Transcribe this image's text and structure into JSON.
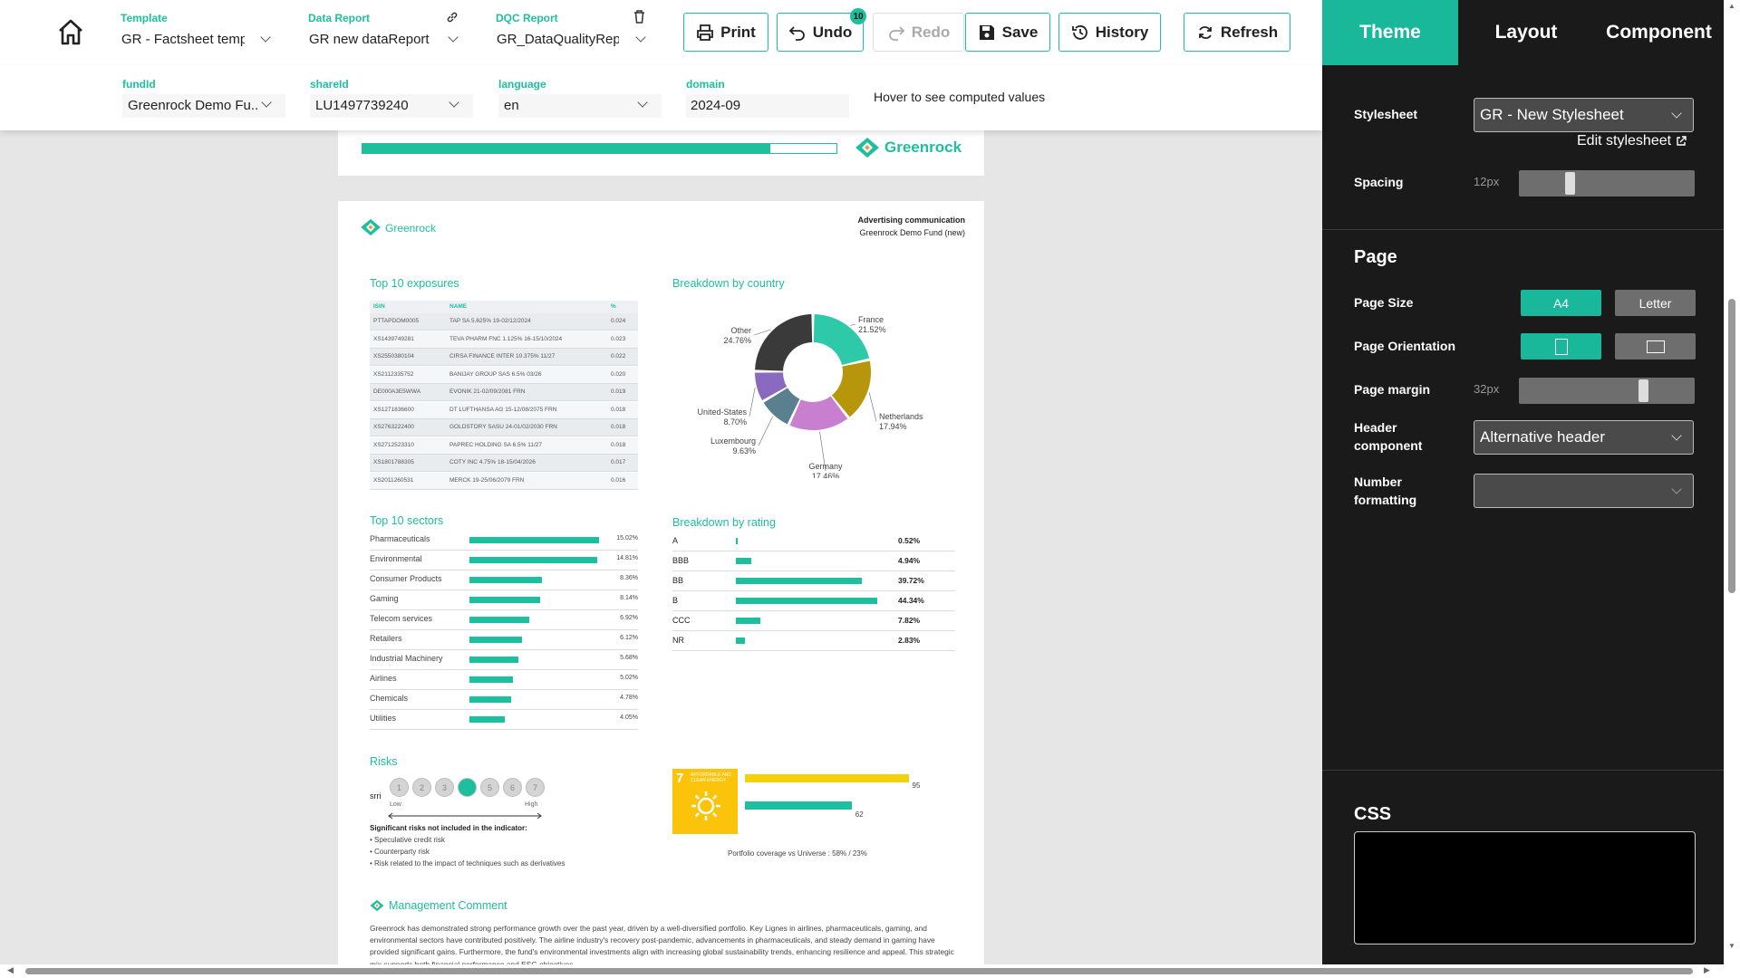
{
  "toolbar": {
    "home_icon": "home-icon",
    "template": {
      "label": "Template",
      "value": "GR - Factsheet temp"
    },
    "data_report": {
      "label": "Data Report",
      "value": "GR new dataReport",
      "icon": "link-icon"
    },
    "dqc_report": {
      "label": "DQC Report",
      "value": "GR_DataQualityRep",
      "icon": "trash-icon"
    },
    "buttons": {
      "print": "Print",
      "undo": "Undo",
      "undo_badge": "10",
      "redo": "Redo",
      "save": "Save",
      "history": "History",
      "refresh": "Refresh"
    }
  },
  "filters": {
    "fundid": {
      "label": "fundId",
      "value": "Greenrock Demo Fu..."
    },
    "shareid": {
      "label": "shareId",
      "value": "LU1497739240"
    },
    "language": {
      "label": "language",
      "value": "en"
    },
    "domain": {
      "label": "domain",
      "value": "2024-09"
    },
    "hint": "Hover to see computed values"
  },
  "panel": {
    "tabs": [
      "Theme",
      "Layout",
      "Component"
    ],
    "stylesheet_label": "Stylesheet",
    "stylesheet_value": "GR - New Stylesheet",
    "edit_stylesheet": "Edit stylesheet",
    "spacing_label": "Spacing",
    "spacing_value": "12px",
    "spacing_level": 0.28,
    "page_title": "Page",
    "page_size_label": "Page Size",
    "page_size_options": [
      "A4",
      "Letter"
    ],
    "page_size_selected": "A4",
    "orientation_label": "Page Orientation",
    "margin_label": "Page margin",
    "margin_value": "32px",
    "margin_level": 0.72,
    "header_label": "Header component",
    "header_value": "Alternative header",
    "number_label": "Number formatting",
    "number_value": "",
    "css_title": "CSS",
    "colors": {
      "accent": "#1dbf9f",
      "bg": "#1a1a1a"
    }
  },
  "doc": {
    "brand": "Greenrock",
    "adv": "Advertising communication",
    "fund": "Greenrock Demo Fund (new)",
    "top10_title": "Top 10 exposures",
    "top10_headers": [
      "ISIN",
      "NAME",
      "%"
    ],
    "top10_rows": [
      [
        "PTTAPDOM0005",
        "TAP SA 5.625% 19-02/12/2024",
        "0.024"
      ],
      [
        "XS1439749281",
        "TEVA PHARM FNC 1.125% 16-15/10/2024",
        "0.023"
      ],
      [
        "XS2550380104",
        "CIRSA FINANCE INTER 10.375% 11/27",
        "0.022"
      ],
      [
        "XS2112335752",
        "BANIJAY GROUP SAS 6.5% 03/26",
        "0.020"
      ],
      [
        "DE000A3E5WWA",
        "EVONIK 21-02/09/2081 FRN",
        "0.019"
      ],
      [
        "XS1271836600",
        "DT LUFTHANSA AG 15-12/08/2075 FRN",
        "0.018"
      ],
      [
        "XS2763222400",
        "GOLDSTORY SASU 24-01/02/2030 FRN",
        "0.018"
      ],
      [
        "XS2712523310",
        "PAPREC HOLDING SA 6.5% 11/27",
        "0.018"
      ],
      [
        "XS1801788305",
        "COTY INC 4.75% 18-15/04/2026",
        "0.017"
      ],
      [
        "XS2011260531",
        "MERCK 19-25/06/2079 FRN",
        "0.016"
      ]
    ],
    "country_title": "Breakdown by country",
    "countries": [
      {
        "name": "France",
        "value": 21.52,
        "label": "21.52%",
        "color": "#2ec9a8"
      },
      {
        "name": "Netherlands",
        "value": 17.94,
        "label": "17.94%",
        "color": "#b8960c"
      },
      {
        "name": "Germany",
        "value": 17.46,
        "label": "17.46%",
        "color": "#c97fd0"
      },
      {
        "name": "Luxembourg",
        "value": 9.63,
        "label": "9.63%",
        "color": "#5a7f8e"
      },
      {
        "name": "United-States",
        "value": 8.7,
        "label": "8.70%",
        "color": "#8a6ac0"
      },
      {
        "name": "Other",
        "value": 24.76,
        "label": "24.76%",
        "color": "#3a3a3a"
      }
    ],
    "sectors_title": "Top 10 sectors",
    "sectors": [
      {
        "name": "Pharmaceuticals",
        "value": 15.02,
        "label": "15.02%"
      },
      {
        "name": "Environmental",
        "value": 14.81,
        "label": "14.81%"
      },
      {
        "name": "Consumer Products",
        "value": 8.36,
        "label": "8.36%"
      },
      {
        "name": "Gaming",
        "value": 8.14,
        "label": "8.14%"
      },
      {
        "name": "Telecom services",
        "value": 6.92,
        "label": "6.92%"
      },
      {
        "name": "Retailers",
        "value": 6.12,
        "label": "6.12%"
      },
      {
        "name": "Industrial Machinery",
        "value": 5.68,
        "label": "5.68%"
      },
      {
        "name": "Airlines",
        "value": 5.02,
        "label": "5.02%"
      },
      {
        "name": "Chemicals",
        "value": 4.78,
        "label": "4.78%"
      },
      {
        "name": "Utilities",
        "value": 4.05,
        "label": "4.05%"
      }
    ],
    "rating_title": "Breakdown by rating",
    "ratings": [
      {
        "name": "A",
        "value": 0.52,
        "label": "0.52%"
      },
      {
        "name": "BBB",
        "value": 4.94,
        "label": "4.94%"
      },
      {
        "name": "BB",
        "value": 39.72,
        "label": "39.72%"
      },
      {
        "name": "B",
        "value": 44.34,
        "label": "44.34%"
      },
      {
        "name": "CCC",
        "value": 7.82,
        "label": "7.82%"
      },
      {
        "name": "NR",
        "value": 2.83,
        "label": "2.83%"
      }
    ],
    "risks_title": "Risks",
    "srri_label": "srri",
    "srri_levels": [
      "1",
      "2",
      "3",
      "4",
      "5",
      "6",
      "7"
    ],
    "srri_selected": 4,
    "risk_low": "Low",
    "risk_high": "High",
    "risk_note_title": "Significant risks not included in the indicator:",
    "risk_notes": [
      "• Speculative credit risk",
      "• Counterparty risk",
      "• Risk related to the impact of techniques such as derivatives"
    ],
    "sdg": {
      "number": "7",
      "caption": "AFFORDABLE AND CLEAN ENERGY",
      "portfolio": 95,
      "universe": 62,
      "portfolio_label": "95",
      "universe_label": "62",
      "coverage": "Portfolio coverage vs Universe : 58% / 23%"
    },
    "comment_title": "Management Comment",
    "comment_text": "Greenrock has demonstrated strong performance growth over the past year, driven by a well-diversified portfolio. Key Lignes in airlines, pharmaceuticals, gaming, and environmental sectors have contributed positively. The airline industry's recovery post-pandemic, advancements in pharmaceuticals, and steady demand in gaming have provided significant gains. Furthermore, the fund's environmental investments align with increasing global sustainability trends, enhancing resilience and appeal. This strategic mix supports both financial performance and ESG objectives."
  }
}
